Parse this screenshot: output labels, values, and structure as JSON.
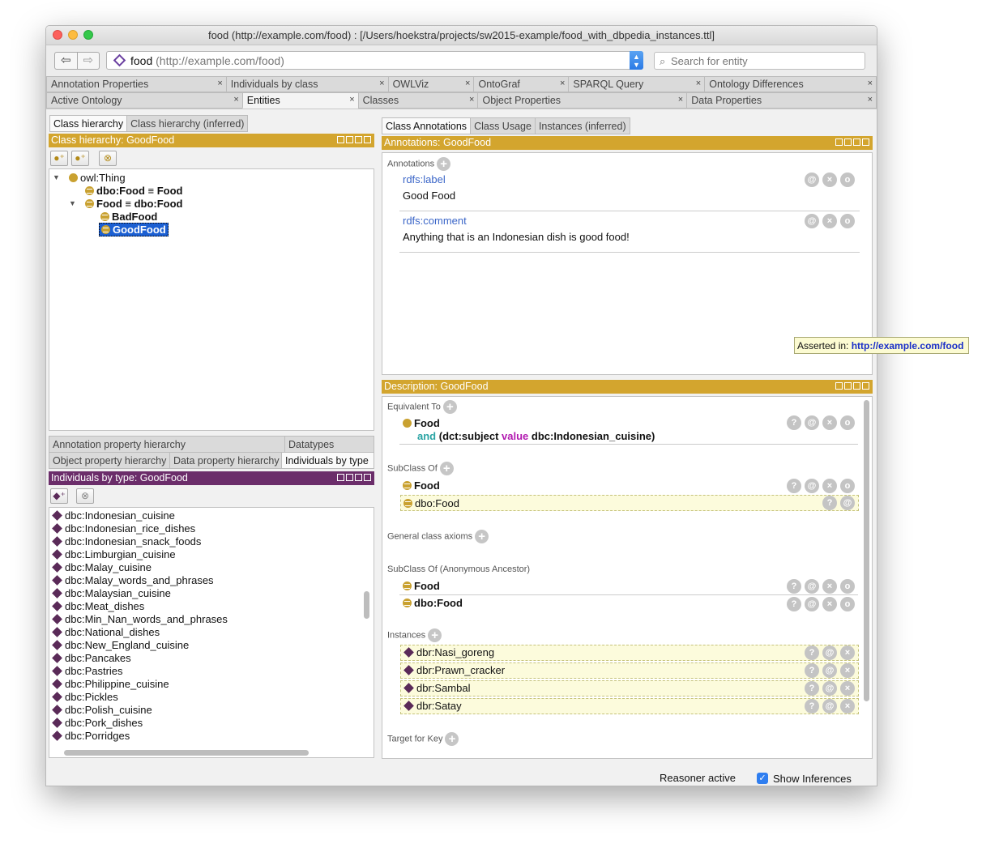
{
  "window": {
    "title": "food (http://example.com/food)  : [/Users/hoekstra/projects/sw2015-example/food_with_dbpedia_instances.ttl]"
  },
  "toolbar": {
    "back_icon": "back-arrow-icon",
    "forward_icon": "forward-arrow-icon",
    "entity_name": "food",
    "entity_iri": "(http://example.com/food)",
    "search_placeholder": "Search for entity"
  },
  "tabs_row1": [
    {
      "label": "Annotation Properties"
    },
    {
      "label": "Individuals by class"
    },
    {
      "label": "OWLViz"
    },
    {
      "label": "OntoGraf"
    },
    {
      "label": "SPARQL Query"
    },
    {
      "label": "Ontology Differences"
    }
  ],
  "tabs_row2": [
    {
      "label": "Active Ontology"
    },
    {
      "label": "Entities",
      "active": true
    },
    {
      "label": "Classes"
    },
    {
      "label": "Object Properties"
    },
    {
      "label": "Data Properties"
    }
  ],
  "left_top": {
    "tabs": [
      "Class hierarchy",
      "Class hierarchy (inferred)"
    ],
    "header": "Class hierarchy: GoodFood",
    "tree": [
      {
        "label": "owl:Thing",
        "bold": false
      },
      {
        "label": "dbo:Food ≡ Food",
        "bold": true
      },
      {
        "label": "Food ≡ dbo:Food",
        "bold": true
      },
      {
        "label": "BadFood",
        "bold": true
      },
      {
        "label": "GoodFood",
        "bold": true,
        "selected": true
      }
    ]
  },
  "left_bottom": {
    "tabs_row1": [
      "Annotation property hierarchy",
      "Datatypes"
    ],
    "tabs_row2": [
      "Object property hierarchy",
      "Data property hierarchy",
      "Individuals by type"
    ],
    "header": "Individuals by type: GoodFood",
    "individuals": [
      "dbc:Indonesian_cuisine",
      "dbc:Indonesian_rice_dishes",
      "dbc:Indonesian_snack_foods",
      "dbc:Limburgian_cuisine",
      "dbc:Malay_cuisine",
      "dbc:Malay_words_and_phrases",
      "dbc:Malaysian_cuisine",
      "dbc:Meat_dishes",
      "dbc:Min_Nan_words_and_phrases",
      "dbc:National_dishes",
      "dbc:New_England_cuisine",
      "dbc:Pancakes",
      "dbc:Pastries",
      "dbc:Philippine_cuisine",
      "dbc:Pickles",
      "dbc:Polish_cuisine",
      "dbc:Pork_dishes",
      "dbc:Porridges"
    ]
  },
  "right_top": {
    "tabs": [
      "Class Annotations",
      "Class Usage",
      "Instances (inferred)"
    ],
    "header": "Annotations: GoodFood",
    "section": "Annotations",
    "annotations": [
      {
        "property": "rdfs:label",
        "value": "Good Food"
      },
      {
        "property": "rdfs:comment",
        "value": "Anything that is an Indonesian dish is good food!"
      }
    ]
  },
  "tooltip": {
    "prefix": "Asserted in:",
    "link": "http://example.com/food"
  },
  "description": {
    "header": "Description: GoodFood",
    "equivalent_label": "Equivalent To",
    "equivalent": {
      "class": "Food",
      "and_kw": "and",
      "restriction_pre": "(dct:subject",
      "value_kw": "value",
      "restriction_post": "dbc:Indonesian_cuisine)"
    },
    "subclass_label": "SubClass Of",
    "subclass": [
      "Food",
      "dbo:Food"
    ],
    "gca_label": "General class axioms",
    "anon_label": "SubClass Of (Anonymous Ancestor)",
    "anon": [
      "Food",
      "dbo:Food"
    ],
    "instances_label": "Instances",
    "instances": [
      "dbr:Nasi_goreng",
      "dbr:Prawn_cracker",
      "dbr:Sambal",
      "dbr:Satay"
    ],
    "target_label": "Target for Key"
  },
  "status": {
    "reasoner": "Reasoner active",
    "show_inferences": "Show Inferences"
  },
  "icons": {
    "help": "?",
    "annotate": "@",
    "delete": "×",
    "edit": "o"
  }
}
